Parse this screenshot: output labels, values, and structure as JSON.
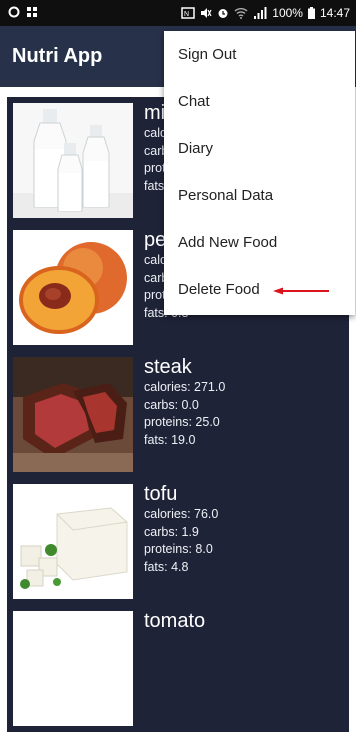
{
  "status_bar": {
    "battery": "100%",
    "time": "14:47"
  },
  "app_bar": {
    "title": "Nutri App"
  },
  "foods": [
    {
      "name": "milk",
      "calories": "calories: 42.0",
      "carbs": "carbs: 5.0",
      "proteins": "proteins: 3.4",
      "fats": "fats: 1.0",
      "image": "milk-bottles"
    },
    {
      "name": "peach",
      "calories": "calories: 39.0",
      "carbs": "carbs: 10.0",
      "proteins": "proteins: 0.9",
      "fats": "fats: 0.3",
      "image": "peach"
    },
    {
      "name": "steak",
      "calories": "calories: 271.0",
      "carbs": "carbs: 0.0",
      "proteins": "proteins: 25.0",
      "fats": "fats: 19.0",
      "image": "steak"
    },
    {
      "name": "tofu",
      "calories": "calories: 76.0",
      "carbs": "carbs: 1.9",
      "proteins": "proteins: 8.0",
      "fats": "fats: 4.8",
      "image": "tofu"
    },
    {
      "name": "tomato",
      "image": "tomato"
    }
  ],
  "overflow_menu": {
    "items": [
      "Sign Out",
      "Chat",
      "Diary",
      "Personal Data",
      "Add New Food",
      "Delete Food"
    ],
    "highlight_arrow_color": "#d9141c"
  }
}
